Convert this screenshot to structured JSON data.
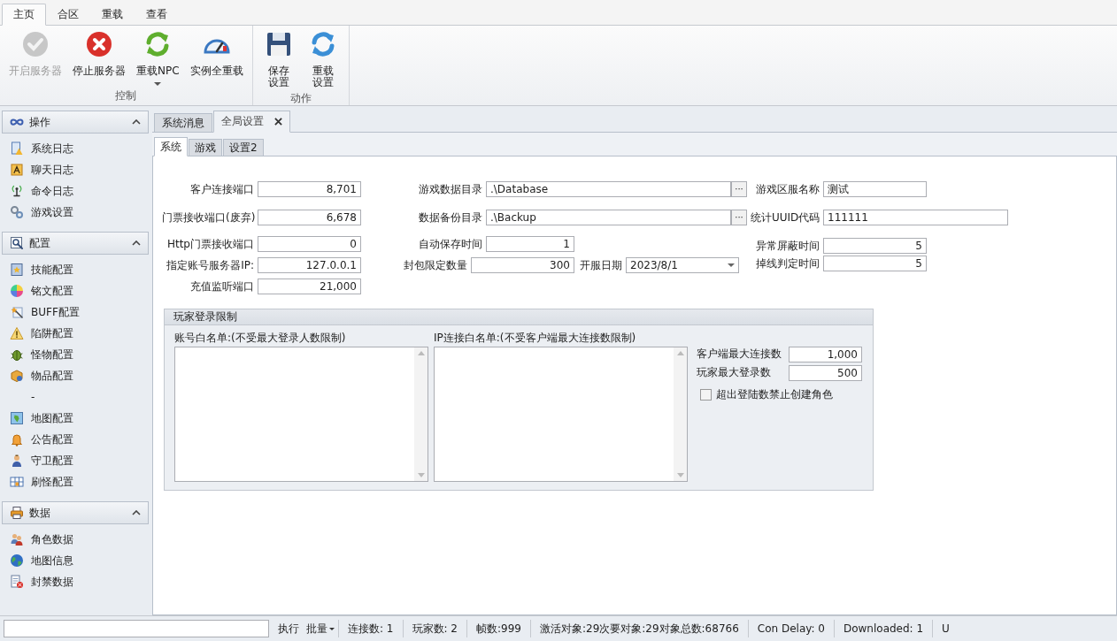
{
  "ribbon": {
    "tabs": [
      {
        "label": "主页",
        "selected": true
      },
      {
        "label": "合区",
        "selected": false
      },
      {
        "label": "重载",
        "selected": false
      },
      {
        "label": "查看",
        "selected": false
      }
    ],
    "groups": [
      {
        "label": "控制",
        "buttons": [
          {
            "label": "开启服务器",
            "disabled": true,
            "dropdown": false
          },
          {
            "label": "停止服务器",
            "disabled": false,
            "dropdown": false
          },
          {
            "label": "重载NPC",
            "disabled": false,
            "dropdown": true
          },
          {
            "label": "实例全重载",
            "disabled": false,
            "dropdown": false
          }
        ]
      },
      {
        "label": "动作",
        "buttons": [
          {
            "label": "保存设置",
            "disabled": false,
            "dropdown": false
          },
          {
            "label": "重载设置",
            "disabled": false,
            "dropdown": false
          }
        ]
      }
    ]
  },
  "sidebar": {
    "sections": [
      {
        "title": "操作",
        "expanded": true,
        "items": [
          {
            "label": "系统日志"
          },
          {
            "label": "聊天日志"
          },
          {
            "label": "命令日志"
          },
          {
            "label": "游戏设置"
          }
        ]
      },
      {
        "title": "配置",
        "expanded": true,
        "items": [
          {
            "label": "技能配置"
          },
          {
            "label": "铭文配置"
          },
          {
            "label": "BUFF配置"
          },
          {
            "label": "陷阱配置"
          },
          {
            "label": "怪物配置"
          },
          {
            "label": "物品配置"
          },
          {
            "label": "-"
          },
          {
            "label": "地图配置"
          },
          {
            "label": "公告配置"
          },
          {
            "label": "守卫配置"
          },
          {
            "label": "刷怪配置"
          }
        ]
      },
      {
        "title": "数据",
        "expanded": true,
        "items": [
          {
            "label": "角色数据"
          },
          {
            "label": "地图信息"
          },
          {
            "label": "封禁数据"
          }
        ]
      }
    ]
  },
  "doc_tabs": [
    {
      "label": "系统消息",
      "selected": false,
      "closable": false
    },
    {
      "label": "全局设置",
      "selected": true,
      "closable": true
    }
  ],
  "sub_tabs": [
    {
      "label": "系统",
      "selected": true
    },
    {
      "label": "游戏",
      "selected": false
    },
    {
      "label": "设置2",
      "selected": false
    }
  ],
  "form": {
    "left": [
      {
        "label": "客户连接端口",
        "value": "8,701"
      },
      {
        "label": "门票接收端口(废弃)",
        "value": "6,678"
      },
      {
        "label": "Http门票接收端口",
        "value": "0"
      },
      {
        "label": "指定账号服务器IP:",
        "value": "127.0.0.1"
      },
      {
        "label": "充值监听端口",
        "value": "21,000"
      }
    ],
    "middle": [
      {
        "kind": "browse",
        "label": "游戏数据目录",
        "value": ".\\Database",
        "button": "···"
      },
      {
        "kind": "browse",
        "label": "数据备份目录",
        "value": ".\\Backup",
        "button": "···"
      },
      {
        "kind": "number",
        "label": "自动保存时间",
        "value": "1"
      },
      {
        "kind": "number_date",
        "label": "封包限定数量",
        "value": "300",
        "date_label": "开服日期",
        "date_value": "2023/8/1"
      }
    ],
    "right": [
      {
        "kind": "text",
        "label": "游戏区服名称",
        "value": "测试"
      },
      {
        "kind": "wide",
        "label": "统计UUID代码",
        "value": "111111"
      },
      {
        "kind": "number",
        "label": "异常屏蔽时间",
        "value": "5"
      },
      {
        "kind": "number",
        "label": "掉线判定时间",
        "value": "5"
      }
    ]
  },
  "login_limits": {
    "title": "玩家登录限制",
    "lists": [
      {
        "label": "账号白名单:(不受最大登录人数限制)"
      },
      {
        "label": "IP连接白名单:(不受客户端最大连接数限制)"
      }
    ],
    "fields": [
      {
        "label": "客户端最大连接数",
        "value": "1,000"
      },
      {
        "label": "玩家最大登录数",
        "value": "500"
      }
    ],
    "checkbox": {
      "label": "超出登陆数禁止创建角色",
      "checked": false
    }
  },
  "status_bar": {
    "execute": "执行",
    "batch": "批量",
    "items": [
      "连接数: 1",
      "玩家数: 2",
      "帧数:999",
      "激活对象:29次要对象:29对象总数:68766",
      "Con Delay: 0",
      "Downloaded: 1",
      "U"
    ]
  }
}
